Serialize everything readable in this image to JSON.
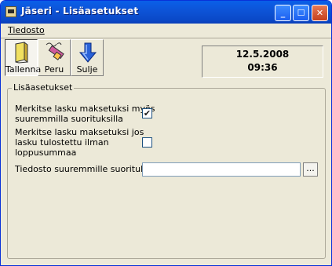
{
  "window": {
    "title": "Jäseri - Lisäasetukset"
  },
  "menu": {
    "file_label": "Tiedosto"
  },
  "toolbar": {
    "save_label": "Tallenna",
    "undo_label": "Peru",
    "close_label": "Sulje",
    "save_icon": "book-icon",
    "undo_icon": "pencil-eraser-icon",
    "close_icon": "down-arrow-icon"
  },
  "datetime": {
    "date": "12.5.2008",
    "time": "09:36"
  },
  "settings": {
    "group_title": "Lisäasetukset",
    "option1_line1": "Merkitse lasku maksetuksi myös",
    "option1_line2": "suuremmilla suorituksilla",
    "option1_checked": true,
    "option1_mark": "✔",
    "option2_line1": "Merkitse lasku maksetuksi jos",
    "option2_line2": "lasku tulostettu ilman",
    "option2_line3": "loppusummaa",
    "option2_checked": false,
    "file_label": "Tiedosto suuremmille suorituksille:",
    "file_value": "",
    "browse_label": "..."
  },
  "colors": {
    "titlebar": "#0a55d8",
    "face": "#ece9d8",
    "close_button": "#c6401c"
  }
}
